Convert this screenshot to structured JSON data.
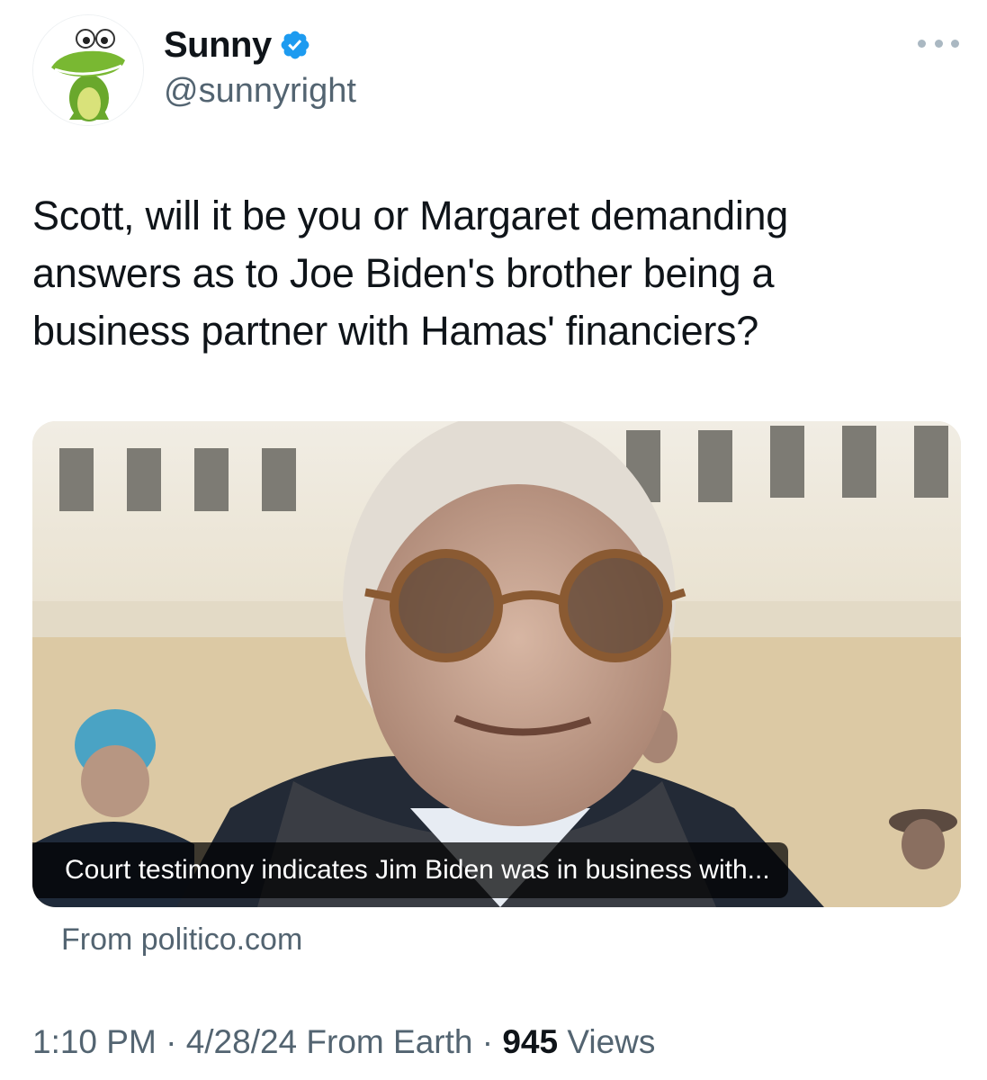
{
  "author": {
    "display_name": "Sunny",
    "handle": "@sunnyright",
    "verified_icon": "verified-badge-icon",
    "avatar_icon": "crocodile-avatar-icon"
  },
  "tweet": {
    "text": "Scott, will it be you or Margaret demanding\nanswers as to Joe Biden's brother being a\nbusiness partner with Hamas' financiers?"
  },
  "link_card": {
    "caption": "Court testimony indicates Jim Biden was in business with...",
    "source": "From politico.com"
  },
  "meta": {
    "time": "1:10 PM",
    "separator": "·",
    "date": "4/28/24",
    "source": "From Earth",
    "views_count": "945",
    "views_label": "Views"
  },
  "colors": {
    "verified": "#1d9bf0",
    "secondary_text": "#536471",
    "primary_text": "#0f1419"
  }
}
